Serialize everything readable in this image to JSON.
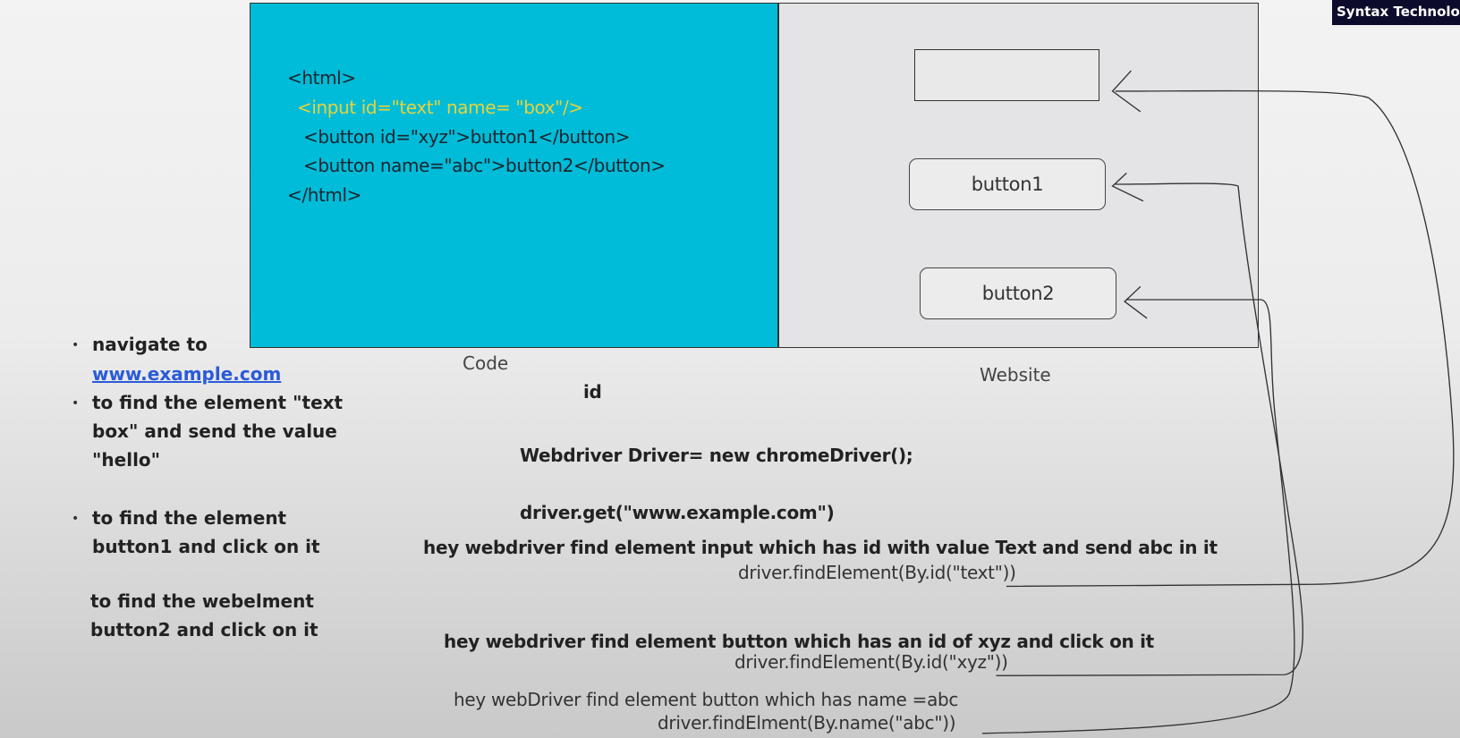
{
  "badge": "Syntax Technologi",
  "code_panel": {
    "label": "Code",
    "lines": [
      "<html>",
      "<input id=\"text\" name= \"box\"/>",
      "<button  id=\"xyz\">button1</button>",
      "<button name=\"abc\">button2</button>",
      "</html>"
    ]
  },
  "website_panel": {
    "label": "Website",
    "button1": "button1",
    "button2": "button2"
  },
  "locator_label": "id",
  "bullets": {
    "b1_text": "navigate to",
    "b1_link": "www.example.com",
    "b2_lines": [
      "to find the element \"text",
      "box\" and send the value",
      "\"hello\""
    ],
    "b3_lines": [
      "to find the element",
      "button1 and click on it"
    ],
    "b4_lines": [
      "to find the webelment",
      "button2 and click on it"
    ]
  },
  "notes": {
    "driver_init": "Webdriver Driver= new chromeDriver();",
    "driver_get": "driver.get(\"www.example.com\")",
    "explain1": "hey webdriver find element input which has id with value Text and send abc in it",
    "code1": "driver.findElement(By.id(\"text\"))",
    "explain2": "hey webdriver find element button which has an id of xyz and click on it",
    "code2": "driver.findElement(By.id(\"xyz\"))",
    "explain3": "hey webDriver find element  button which has name =abc",
    "code3": "driver.findElment(By.name(\"abc\"))"
  },
  "colors": {
    "code_bg": "#00bcd8",
    "highlight": "#e8d23a",
    "link": "#2a5bd7"
  }
}
